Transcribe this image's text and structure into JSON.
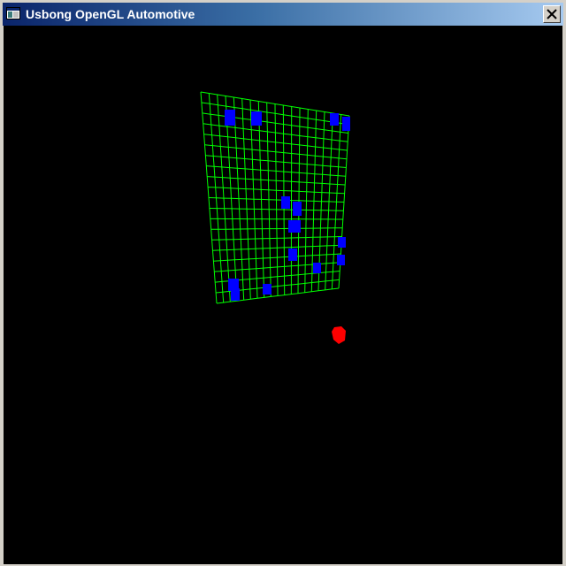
{
  "window": {
    "title": "Usbong OpenGL Automotive",
    "app_icon": "window-app-icon",
    "close_icon": "close-x-icon"
  },
  "scene": {
    "background_color": "#000000",
    "grid_color": "#00ff00",
    "block_color": "#0000ff",
    "player_color": "#ff0000",
    "grid_rows": 20,
    "grid_cols": 18
  }
}
